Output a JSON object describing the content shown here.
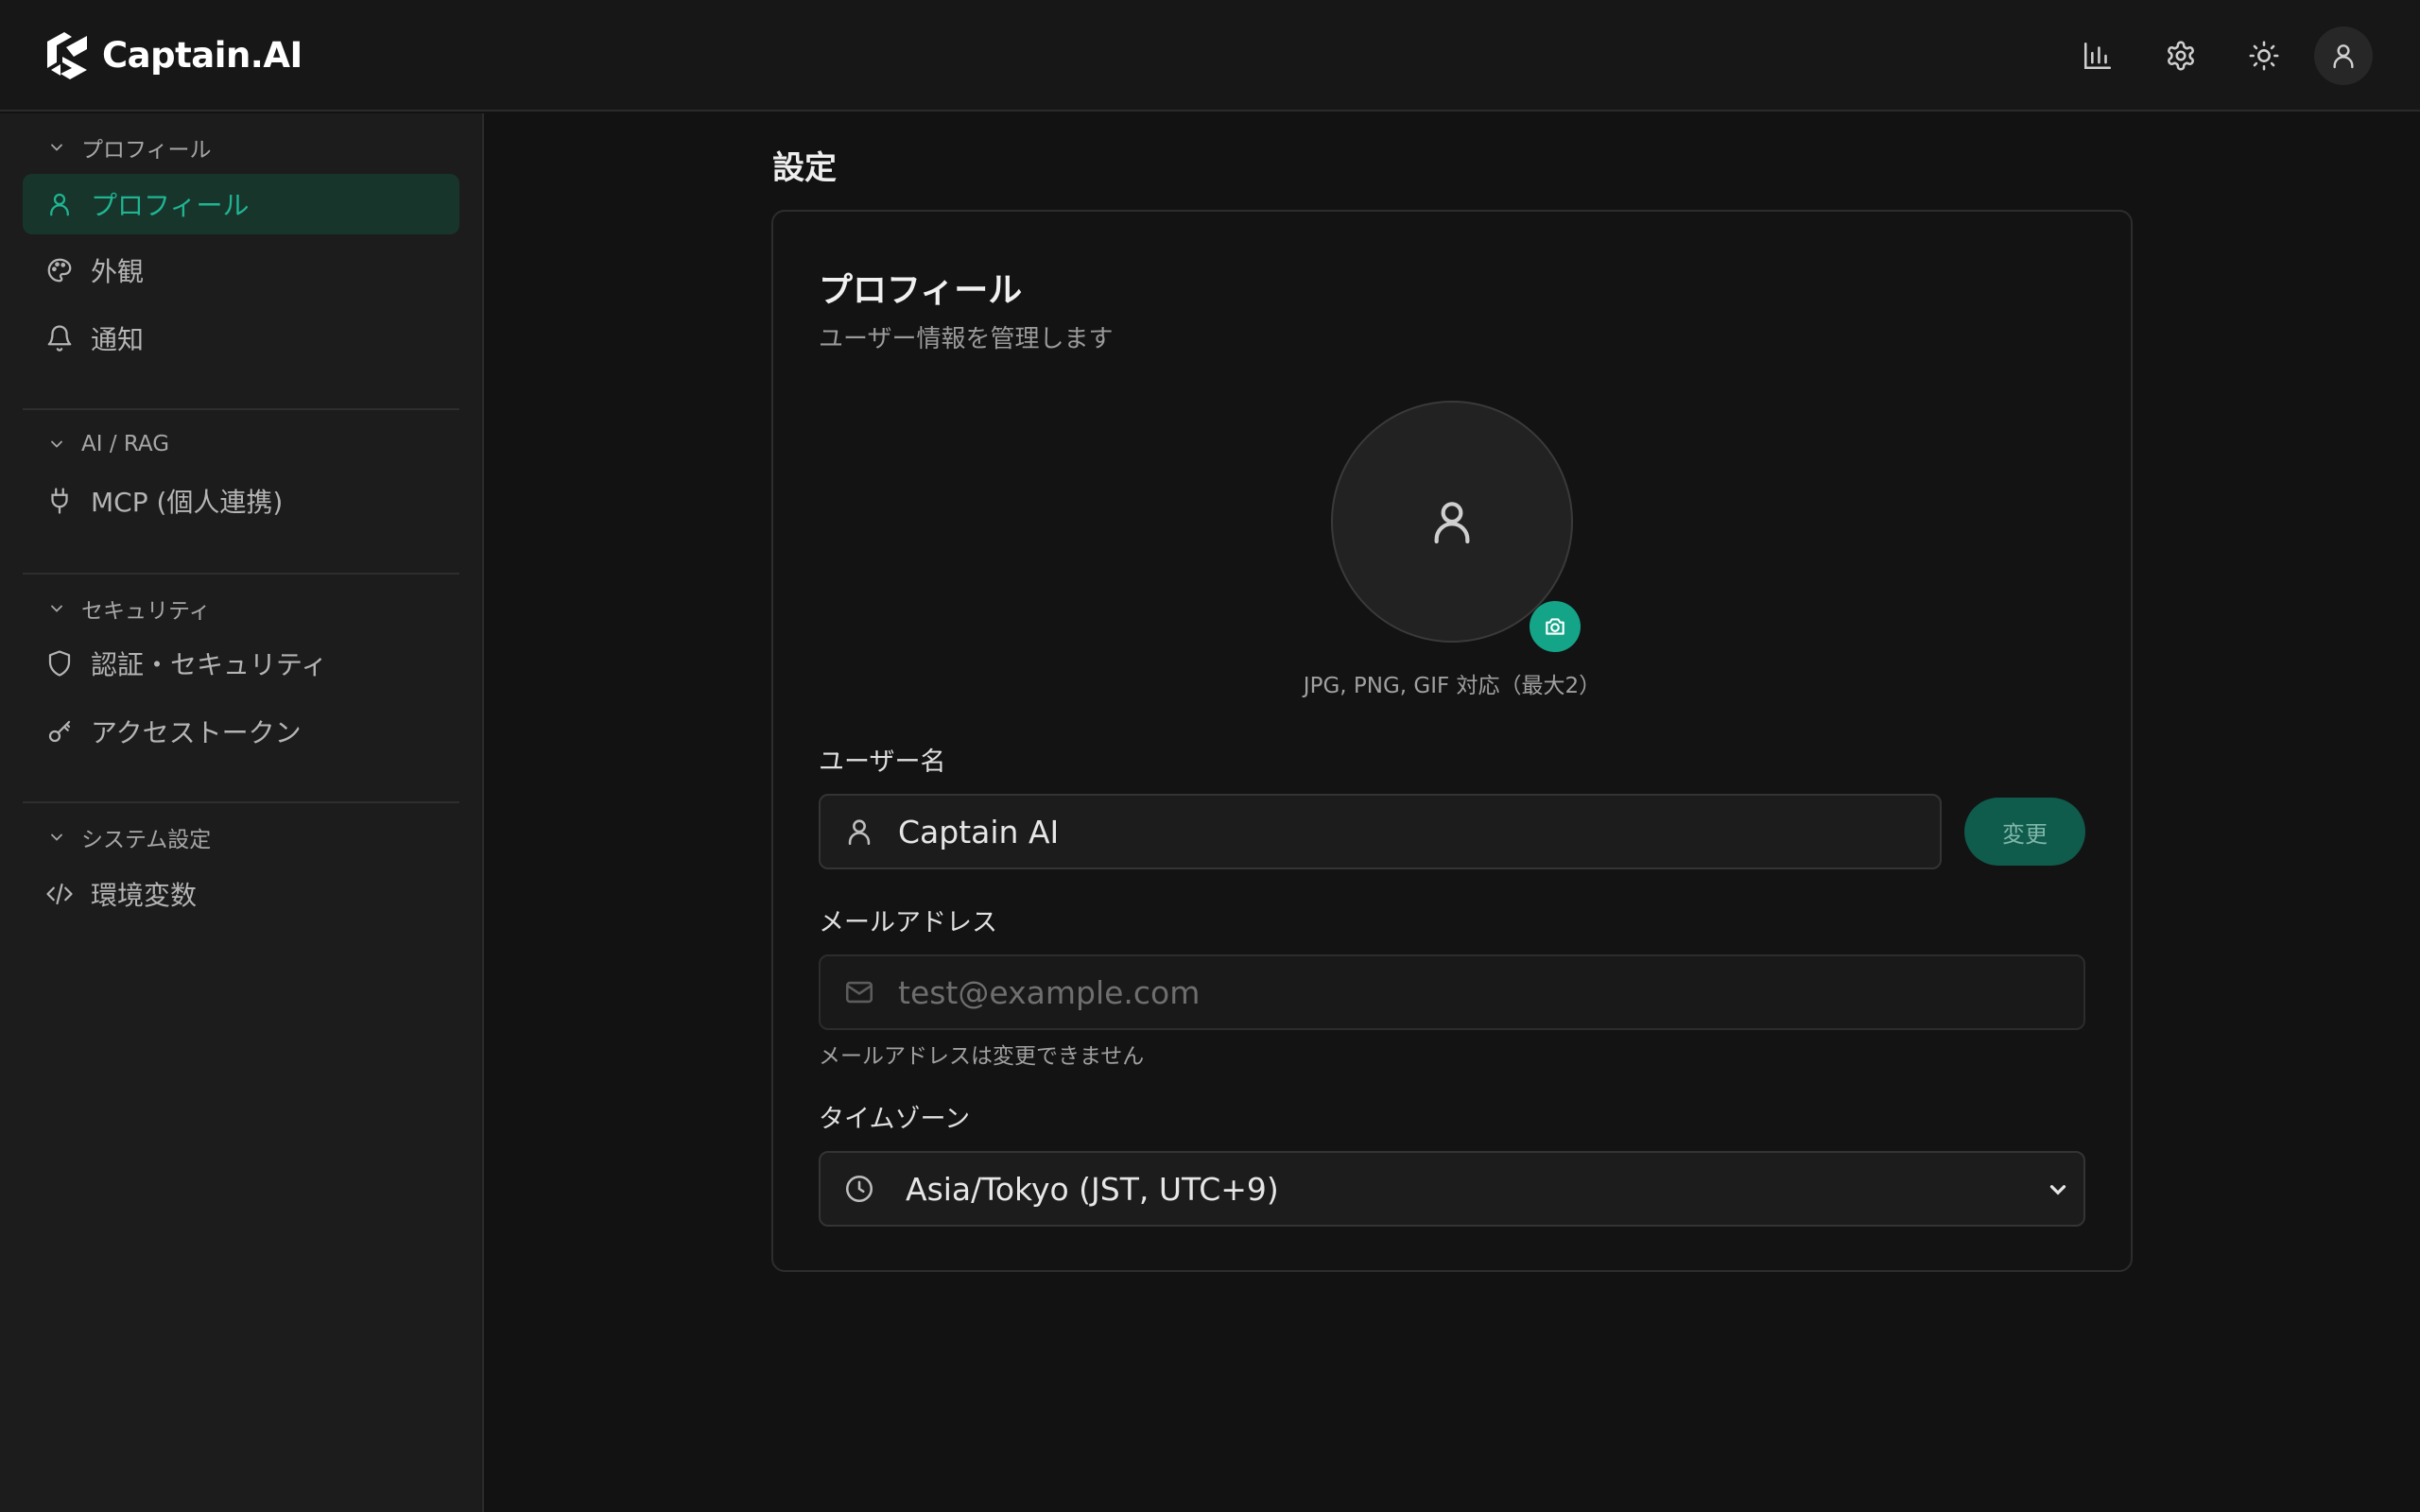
{
  "app": {
    "title": "Captain.AI"
  },
  "header": {
    "icons": [
      "bar-chart-icon",
      "gear-icon",
      "sun-icon",
      "user-icon"
    ]
  },
  "sidebar": {
    "sections": [
      {
        "title": "プロフィール",
        "items": [
          {
            "label": "プロフィール",
            "icon": "user-icon",
            "active": true
          },
          {
            "label": "外観",
            "icon": "palette-icon"
          },
          {
            "label": "通知",
            "icon": "bell-icon"
          }
        ]
      },
      {
        "title": "AI / RAG",
        "items": [
          {
            "label": "MCP (個人連携)",
            "icon": "plug-icon"
          }
        ]
      },
      {
        "title": "セキュリティ",
        "items": [
          {
            "label": "認証・セキュリティ",
            "icon": "shield-icon"
          },
          {
            "label": "アクセストークン",
            "icon": "key-icon"
          }
        ]
      },
      {
        "title": "システム設定",
        "items": [
          {
            "label": "環境変数",
            "icon": "code-icon"
          }
        ]
      }
    ]
  },
  "main": {
    "page_title": "設定",
    "card": {
      "title": "プロフィール",
      "subtitle": "ユーザー情報を管理します",
      "avatar_hint": "JPG, PNG, GIF 対応（最大2）",
      "username": {
        "label": "ユーザー名",
        "value": "Captain AI",
        "button": "変更"
      },
      "email": {
        "label": "メールアドレス",
        "placeholder": "test@example.com",
        "help": "メールアドレスは変更できません"
      },
      "timezone": {
        "label": "タイムゾーン",
        "value": "Asia/Tokyo (JST, UTC+9)"
      }
    }
  },
  "colors": {
    "accent": "#14a488",
    "active_bg": "#18352c",
    "background": "#121212"
  }
}
